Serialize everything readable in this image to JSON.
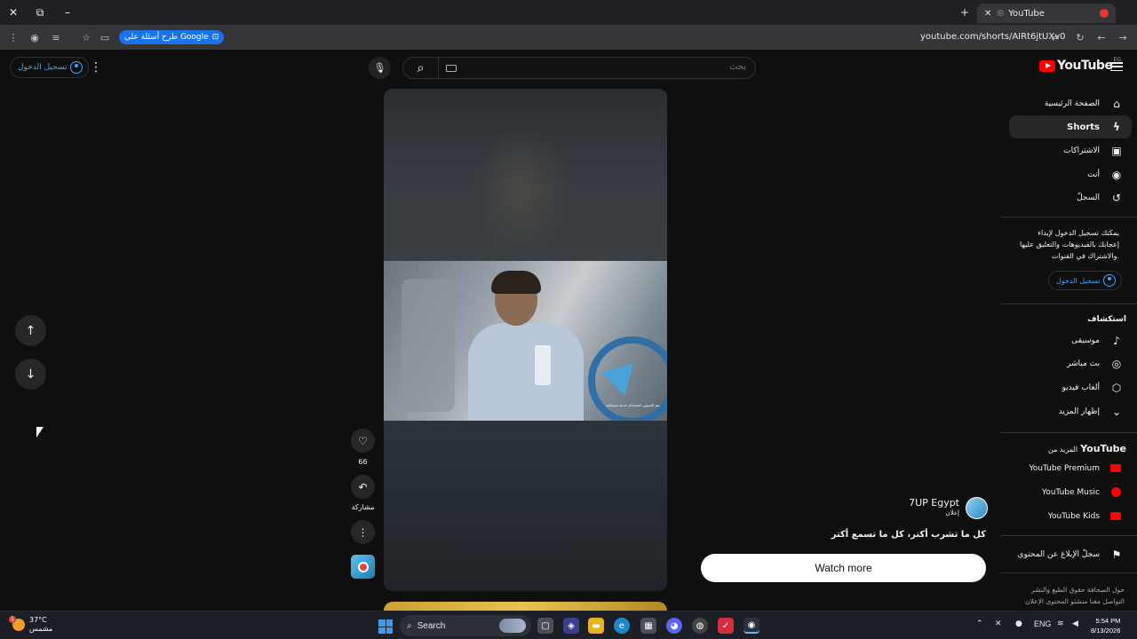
{
  "browser": {
    "tab_title": "YouTube",
    "url": "youtube.com/shorts/AIRt6jtUXv0",
    "google_pill": "طرح أسئلة على Google"
  },
  "masthead": {
    "logo_text": "YouTube",
    "country_code": "EG",
    "search_placeholder": "بحث",
    "signin_label": "تسجيل الدخول"
  },
  "sidebar": {
    "items": [
      {
        "label": "الصفحة الرئيسية",
        "icon": "home-icon"
      },
      {
        "label": "Shorts",
        "icon": "shorts-icon",
        "active": true
      },
      {
        "label": "الاشتراكات",
        "icon": "subscriptions-icon"
      },
      {
        "label": "أنت",
        "icon": "you-icon"
      },
      {
        "label": "السجلّ",
        "icon": "history-icon"
      }
    ],
    "signin_prompt": "يمكنك تسجيل الدخول لإبداء إعجابك بالفيديوهات والتعليق عليها والاشتراك في القنوات.",
    "signin_label": "تسجيل الدخول",
    "explore_heading": "استكشاف",
    "explore": [
      {
        "label": "موسيقى",
        "icon": "music-icon"
      },
      {
        "label": "بث مباشر",
        "icon": "live-icon"
      },
      {
        "label": "ألعاب فيديو",
        "icon": "gaming-icon"
      },
      {
        "label": "إظهار المزيد",
        "icon": "chevron-down-icon"
      }
    ],
    "more_heading_prefix": "المزيد من",
    "more_heading_brand": "YouTube",
    "more": [
      {
        "label": "YouTube Premium"
      },
      {
        "label": "YouTube Music"
      },
      {
        "label": "YouTube Kids"
      }
    ],
    "report_label": "سجلّ الإبلاغ عن المحتوى",
    "footer_line1": "حول  الصحافة  حقوق الطبع والنشر",
    "footer_line2": "التواصل معنا  منشئو المحتوى  الإعلان"
  },
  "short": {
    "like_count": "66",
    "share_label": "مشاركة",
    "channel_name": "7UP Egypt",
    "sponsored": "إعلان",
    "title": "كل ما تشرب أكتر، كل ما تسمع أكتر",
    "watch_more": "Watch more",
    "video_caption": "يتم التصوير باستخدام خدعة سينمائية"
  },
  "taskbar": {
    "temperature": "37°C",
    "weather": "مشمس",
    "search_label": "Search",
    "lang": "ENG",
    "time": "5:54 PM",
    "date": "8/13/2026"
  }
}
